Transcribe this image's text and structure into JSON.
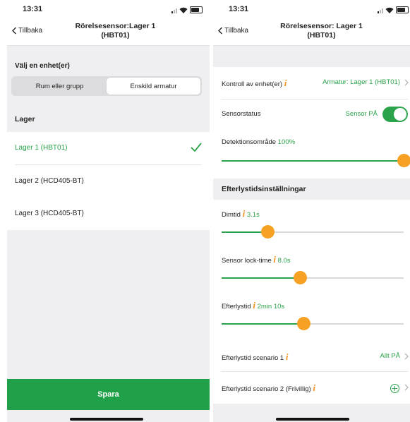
{
  "status": {
    "time": "13:31"
  },
  "left": {
    "nav": {
      "back": "Tillbaka",
      "title_line1": "Rörelsesensor:Lager 1",
      "title_line2": "(HBT01)"
    },
    "select_label": "Välj en enhet(er)",
    "segments": [
      "Rum eller grupp",
      "Enskild armatur"
    ],
    "active_segment": "Enskild armatur",
    "group_header": "Lager",
    "devices": [
      {
        "name": "Lager 1 (HBT01)",
        "selected": true
      },
      {
        "name": "Lager 2 (HCD405-BT)",
        "selected": false
      },
      {
        "name": "Lager 3 (HCD405-BT)",
        "selected": false
      }
    ],
    "save": "Spara"
  },
  "right": {
    "nav": {
      "back": "Tillbaka",
      "title_line1": "Rörelsesensor: Lager 1",
      "title_line2": "(HBT01)"
    },
    "control": {
      "label": "Kontroll av enhet(er)",
      "value": "Armatur: Lager 1 (HBT01)"
    },
    "sensor_status": {
      "label": "Sensorstatus",
      "value": "Sensor PÅ",
      "on": true
    },
    "detection": {
      "label": "Detektionsområde",
      "value": "100%",
      "level": 1.0
    },
    "section_header": "Efterlystidsinställningar",
    "sliders": [
      {
        "label": "Dimtid",
        "value": "3.1s",
        "level": 0.25
      },
      {
        "label": "Sensor lock-time",
        "value": "8.0s",
        "level": 0.43
      },
      {
        "label": "Efterlystid",
        "value": "2min 10s",
        "level": 0.45
      }
    ],
    "scenario1": {
      "label": "Efterlystid scenario 1",
      "value": "Allt PÅ"
    },
    "scenario2": {
      "label": "Efterlystid scenario 2 (Frivillig)"
    }
  },
  "colors": {
    "green": "#2aa34a",
    "orange": "#f7a124",
    "save_button": "#20a048"
  }
}
